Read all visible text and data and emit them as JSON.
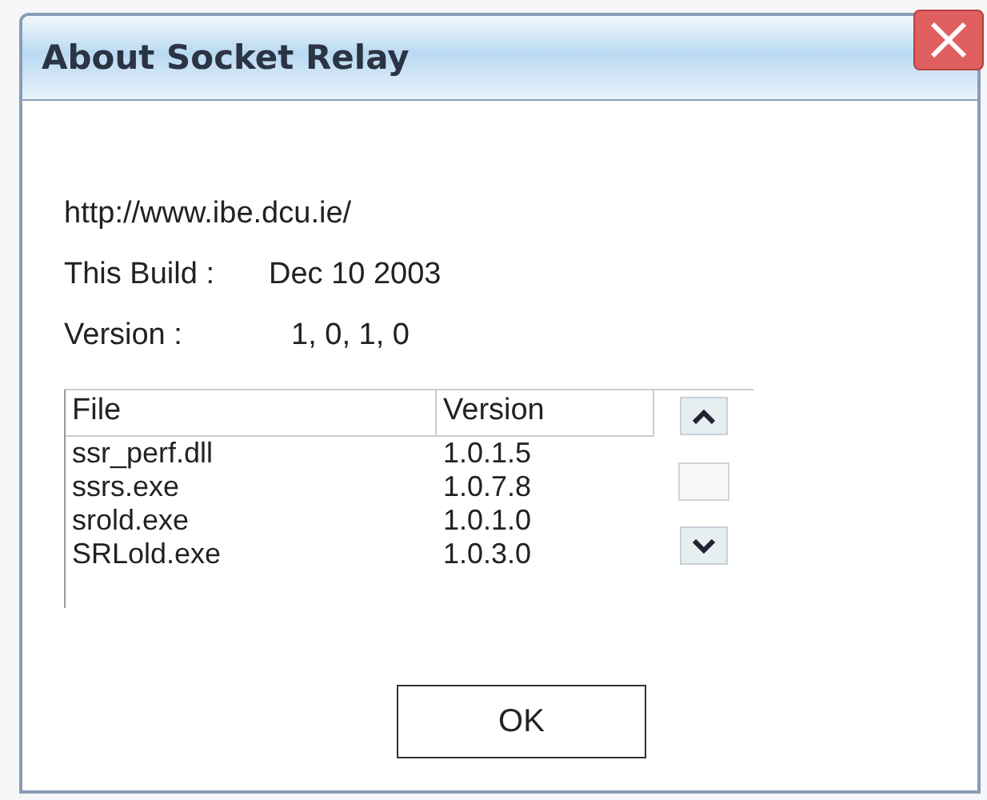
{
  "window": {
    "title": "About Socket Relay"
  },
  "info": {
    "url": "http://www.ibe.dcu.ie/",
    "build_label": "This Build :",
    "build_value": "Dec 10 2003",
    "version_label": "Version :",
    "version_value": "1, 0, 1, 0"
  },
  "table": {
    "columns": [
      "File",
      "Version"
    ],
    "rows": [
      {
        "file": "ssr_perf.dll",
        "version": "1.0.1.5"
      },
      {
        "file": "ssrs.exe",
        "version": "1.0.7.8"
      },
      {
        "file": "srold.exe",
        "version": "1.0.1.0"
      },
      {
        "file": "SRLold.exe",
        "version": "1.0.3.0"
      }
    ]
  },
  "buttons": [
    "OK"
  ]
}
